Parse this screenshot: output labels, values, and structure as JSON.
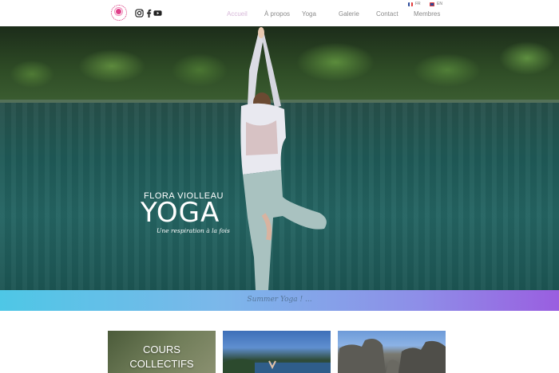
{
  "header": {
    "nav": [
      {
        "label": "Accueil",
        "active": true
      },
      {
        "label": "À propos",
        "active": false
      },
      {
        "label": "Yoga",
        "active": false
      },
      {
        "label": "Galerie",
        "active": false
      },
      {
        "label": "Contact",
        "active": false
      },
      {
        "label": "Membres",
        "active": false
      }
    ],
    "languages": [
      {
        "code": "FR",
        "flag_color": "#e23b3b"
      },
      {
        "code": "EN",
        "flag_color": "#2b4a9a"
      }
    ],
    "social": [
      "instagram-icon",
      "facebook-icon",
      "youtube-icon"
    ]
  },
  "hero": {
    "name": "FLORA VIOLLEAU",
    "title": "YOGA",
    "tagline": "Une respiration à la fois"
  },
  "banner": {
    "text": "Summer Yoga ! ..."
  },
  "cards": [
    {
      "label_line1": "COURS",
      "label_line2": "COLLECTIFS"
    },
    {
      "label_line1": "",
      "label_line2": ""
    },
    {
      "label_line1": "",
      "label_line2": ""
    }
  ],
  "colors": {
    "accent_active_nav": "#d7b8d9",
    "logo": "#e0408a",
    "banner_start": "#4ec7e6",
    "banner_end": "#9a5ee0"
  }
}
